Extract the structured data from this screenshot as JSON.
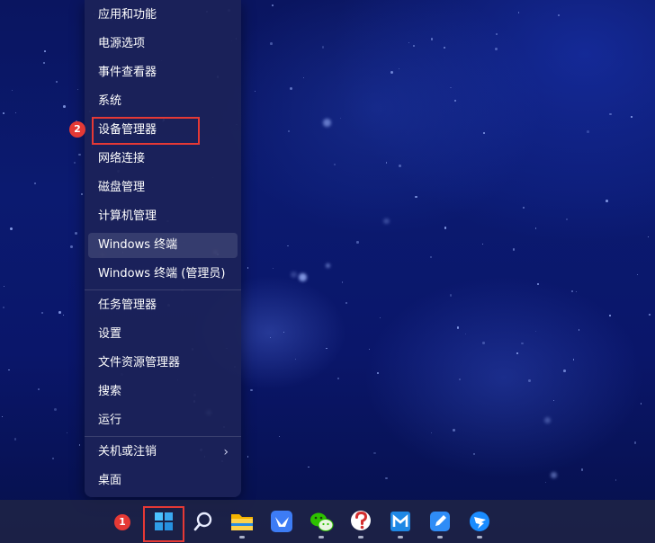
{
  "menu": {
    "items": [
      {
        "label": "应用和功能"
      },
      {
        "label": "电源选项"
      },
      {
        "label": "事件查看器"
      },
      {
        "label": "系统"
      },
      {
        "label": "设备管理器"
      },
      {
        "label": "网络连接"
      },
      {
        "label": "磁盘管理"
      },
      {
        "label": "计算机管理"
      },
      {
        "label": "Windows 终端"
      },
      {
        "label": "Windows 终端 (管理员)"
      },
      {
        "label": "任务管理器"
      },
      {
        "label": "设置"
      },
      {
        "label": "文件资源管理器"
      },
      {
        "label": "搜索"
      },
      {
        "label": "运行"
      },
      {
        "label": "关机或注销"
      },
      {
        "label": "桌面"
      }
    ],
    "submenu_chevron": "›"
  },
  "annotations": {
    "step1": "1",
    "step2": "2",
    "highlight_color": "#e53935"
  },
  "taskbar": {
    "icons": [
      "windows-start-icon",
      "search-icon",
      "file-explorer-icon",
      "feishu-icon",
      "wechat-icon",
      "help-icon",
      "maxthon-icon",
      "note-edit-icon",
      "dingtalk-icon"
    ]
  },
  "colors": {
    "menu_bg": "#1c2258",
    "taskbar_bg": "#202446",
    "accent": "#e53935"
  }
}
